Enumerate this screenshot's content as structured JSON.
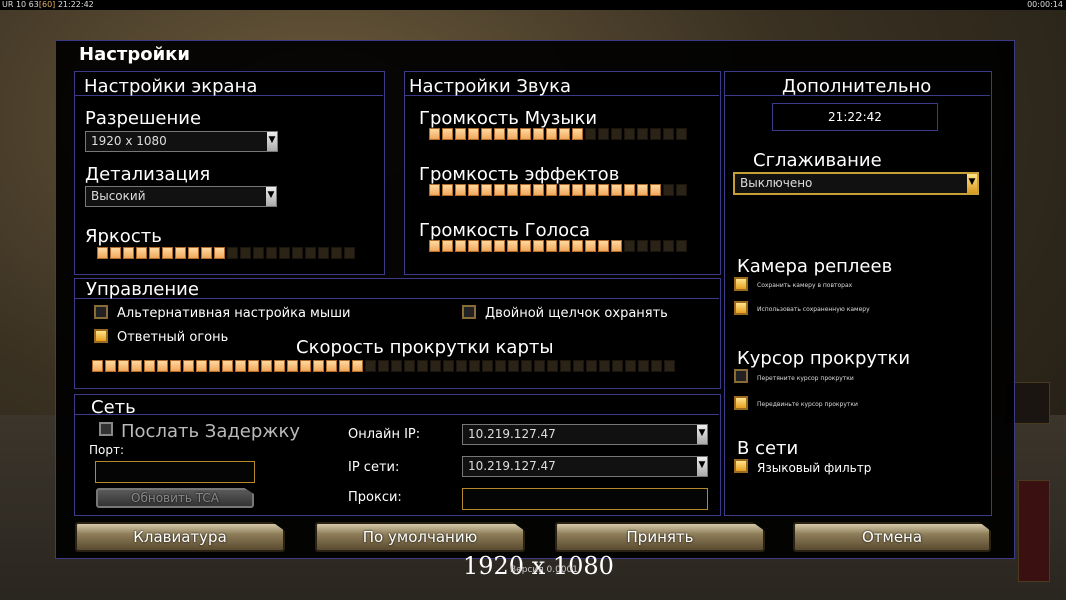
{
  "topbar": {
    "left_text": "UR 10 63",
    "left_fps": "[60]",
    "left_time": "21:22:42",
    "right_text": "00:00:14"
  },
  "dialog_title": "Настройки",
  "screen": {
    "header": "Настройки экрана",
    "resolution_label": "Разрешение",
    "resolution_value": "1920 x 1080",
    "detail_label": "Детализация",
    "detail_value": "Высокий",
    "brightness_label": "Яркость",
    "brightness_level": 0.52
  },
  "sound": {
    "header": "Настройки Звука",
    "music_label": "Громкость Музыки",
    "music_level": 0.6,
    "effects_label": "Громкость эффектов",
    "effects_level": 0.88,
    "voice_label": "Громкость Голоса",
    "voice_level": 0.76
  },
  "extra": {
    "header": "Дополнительно",
    "clock": "21:22:42",
    "aa_label": "Сглаживание",
    "aa_value": "Выключено",
    "replay_cam_header": "Камера реплеев",
    "replay_opt1": "Сохранить камеру в повторах",
    "replay_opt2": "Использовать сохраненную камеру",
    "scroll_cursor_header": "Курсор прокрутки",
    "scroll_opt1": "Перетяните курсор прокрутки",
    "scroll_opt2": "Передвиньте курсор прокрутки",
    "online_header": "В сети",
    "lang_filter": "Языковый фильтр"
  },
  "control": {
    "header": "Управление",
    "alt_mouse": "Альтернативная настройка мыши",
    "double_click": "Двойной щелчок охранять",
    "retaliation": "Ответный огонь",
    "scroll_speed_label": "Скорость прокрутки карты",
    "scroll_speed_level": 0.47
  },
  "network": {
    "header": "Сеть",
    "send_delay": "Послать Задержку",
    "port_label": "Порт:",
    "update_btn": "Обновить TCA",
    "online_ip_label": "Онлайн IP:",
    "online_ip_value": "10.219.127.47",
    "lan_ip_label": "IP сети:",
    "lan_ip_value": "10.219.127.47",
    "proxy_label": "Прокси:"
  },
  "buttons": {
    "keyboard": "Клавиатура",
    "default": "По умолчанию",
    "accept": "Принять",
    "cancel": "Отмена"
  },
  "footer": {
    "resolution": "1920 x 1080",
    "version": "Версия 0.0001"
  },
  "colors": {
    "panel_border": "#3b3b8a",
    "bar_on": "#f0a95c",
    "gold": "#c9a036"
  }
}
